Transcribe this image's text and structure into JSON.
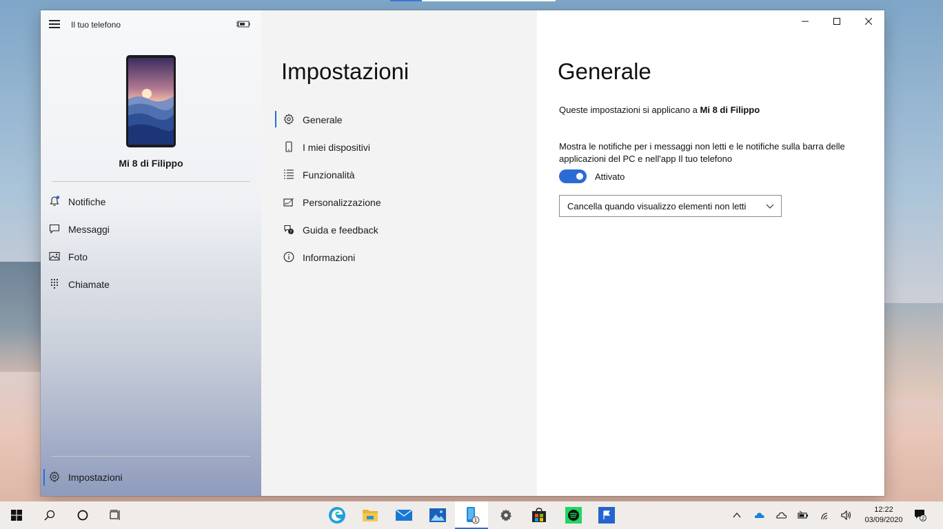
{
  "app": {
    "title": "Il tuo telefono",
    "device_name": "Mi 8 di Filippo"
  },
  "nav": {
    "items": [
      {
        "label": "Notifiche",
        "icon": "bell-icon"
      },
      {
        "label": "Messaggi",
        "icon": "chat-icon"
      },
      {
        "label": "Foto",
        "icon": "photo-icon"
      },
      {
        "label": "Chiamate",
        "icon": "dialpad-icon"
      }
    ],
    "settings_label": "Impostazioni"
  },
  "settings": {
    "title": "Impostazioni",
    "items": [
      {
        "label": "Generale",
        "icon": "gear-icon",
        "active": true
      },
      {
        "label": "I miei dispositivi",
        "icon": "phone-icon"
      },
      {
        "label": "Funzionalità",
        "icon": "list-icon"
      },
      {
        "label": "Personalizzazione",
        "icon": "paint-icon"
      },
      {
        "label": "Guida e feedback",
        "icon": "help-icon"
      },
      {
        "label": "Informazioni",
        "icon": "info-icon"
      }
    ]
  },
  "detail": {
    "title": "Generale",
    "applies_prefix": "Queste impostazioni si applicano a",
    "applies_device": "Mi 8 di Filippo",
    "notif_description": "Mostra le notifiche per i messaggi non letti e le notifiche sulla barra delle applicazioni del PC e nell'app Il tuo telefono",
    "toggle_state": "Attivato",
    "toggle_on": true,
    "dropdown_value": "Cancella quando visualizzo elementi non letti"
  },
  "taskbar": {
    "time": "12:22",
    "date": "03/09/2020",
    "phone_badge": "1",
    "notification_count": "2"
  },
  "colors": {
    "accent": "#2b6bd6"
  }
}
